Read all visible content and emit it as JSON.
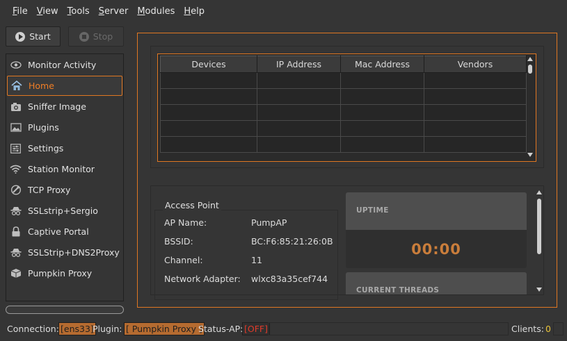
{
  "menubar": {
    "items": [
      {
        "label": "File"
      },
      {
        "label": "View"
      },
      {
        "label": "Tools"
      },
      {
        "label": "Server"
      },
      {
        "label": "Modules"
      },
      {
        "label": "Help"
      }
    ]
  },
  "toolbar": {
    "start_label": "Start",
    "stop_label": "Stop"
  },
  "sidebar": {
    "items": [
      {
        "label": "Monitor Activity",
        "icon": "eye-icon"
      },
      {
        "label": "Home",
        "icon": "home-icon",
        "active": true
      },
      {
        "label": "Sniffer Image",
        "icon": "camera-icon"
      },
      {
        "label": "Plugins",
        "icon": "image-icon"
      },
      {
        "label": "Settings",
        "icon": "sliders-icon"
      },
      {
        "label": "Station Monitor",
        "icon": "wifi-icon"
      },
      {
        "label": "TCP Proxy",
        "icon": "satellite-icon"
      },
      {
        "label": "SSLstrip+Sergio",
        "icon": "spy-icon"
      },
      {
        "label": "Captive Portal",
        "icon": "lock-icon"
      },
      {
        "label": "SSLStrip+DNS2Proxy",
        "icon": "spy-icon"
      },
      {
        "label": "Pumpkin Proxy",
        "icon": "box-icon"
      }
    ]
  },
  "devices_table": {
    "columns": [
      "Devices",
      "IP Address",
      "Mac Address",
      "Vendors"
    ],
    "rows": [
      [
        "",
        "",
        "",
        ""
      ],
      [
        "",
        "",
        "",
        ""
      ],
      [
        "",
        "",
        "",
        ""
      ],
      [
        "",
        "",
        "",
        ""
      ],
      [
        "",
        "",
        "",
        ""
      ]
    ]
  },
  "access_point": {
    "title": "Access Point",
    "fields": [
      {
        "label": "AP Name:",
        "value": "PumpAP"
      },
      {
        "label": "BSSID:",
        "value": "BC:F6:85:21:26:0B"
      },
      {
        "label": "Channel:",
        "value": "11"
      },
      {
        "label": "Network Adapter:",
        "value": "wlxc83a35cef744"
      }
    ]
  },
  "uptime": {
    "title": "UPTIME",
    "value": "00:00"
  },
  "threads": {
    "title": "CURRENT THREADS"
  },
  "statusbar": {
    "connection_label": "Connection:",
    "connection_value": "[ens33]",
    "plugin_label": "Plugin:",
    "plugin_value": "[ Pumpkin Proxy ]",
    "status_ap_label": "Status-AP:",
    "status_ap_value": "[OFF]",
    "clients_label": "Clients:",
    "clients_value": "0"
  },
  "colors": {
    "accent": "#e07722",
    "status_off": "#e03a2a",
    "clients_count": "#e8c33a"
  }
}
